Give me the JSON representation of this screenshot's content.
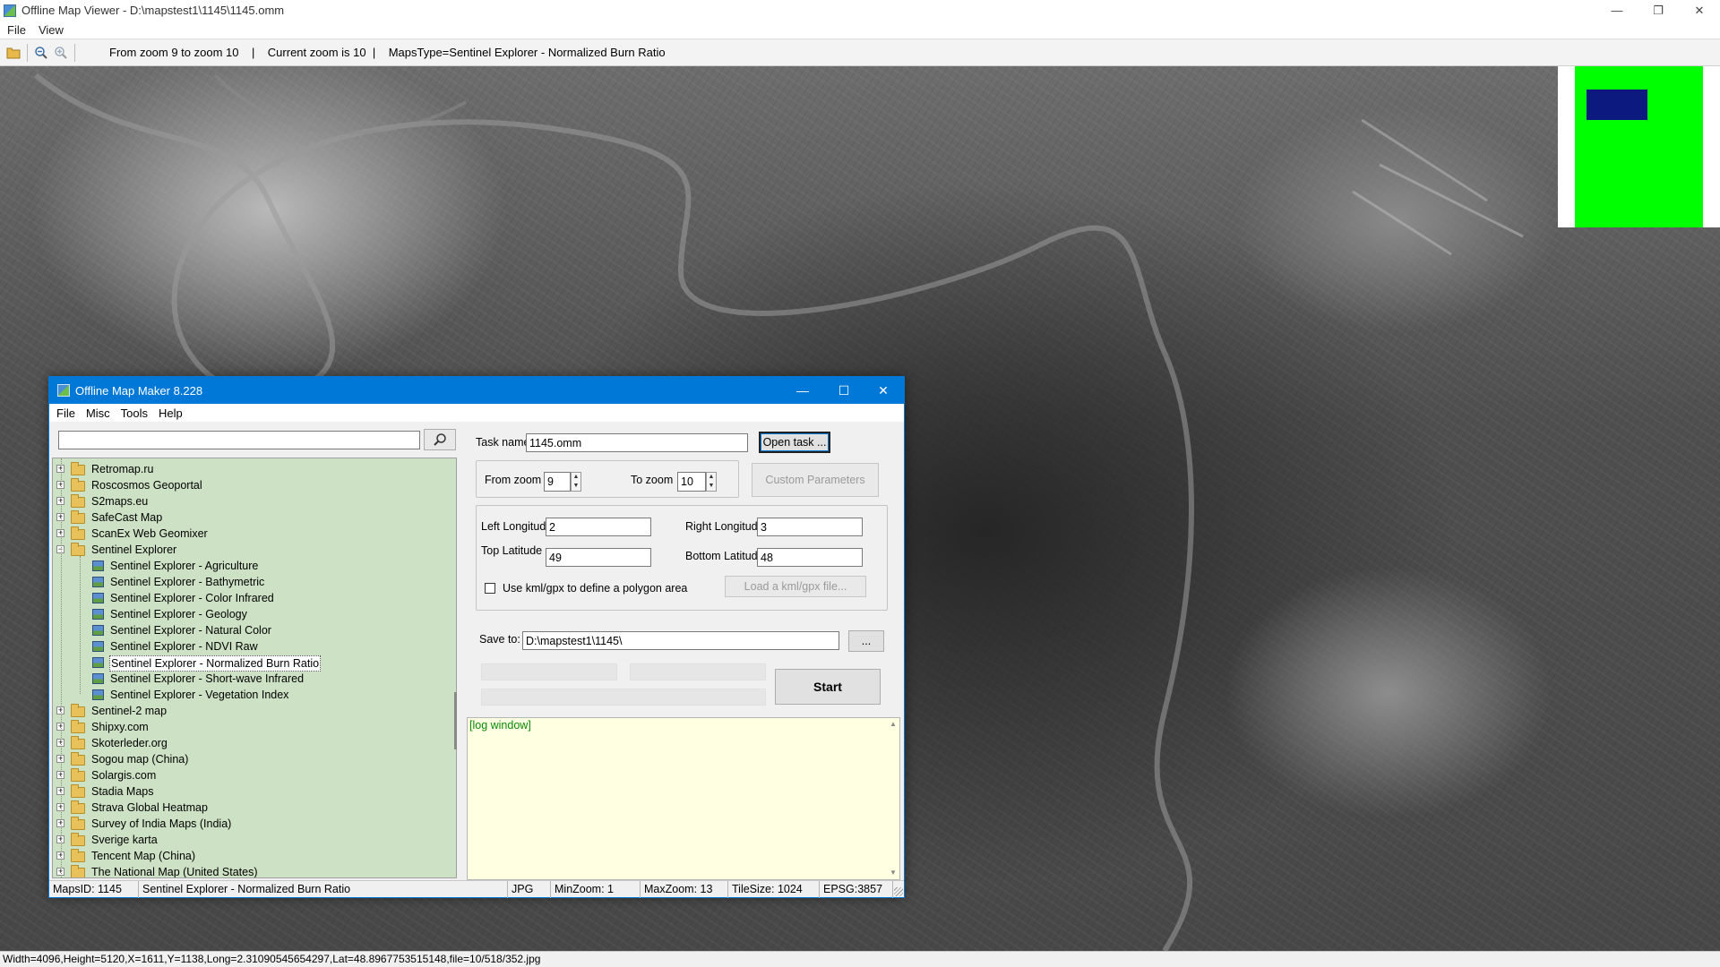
{
  "window": {
    "title": "Offline Map Viewer - D:\\mapstest1\\1145\\1145.omm",
    "menu": [
      "File",
      "View"
    ]
  },
  "toolbar": {
    "zoom_range_text": "From zoom 9 to zoom 10",
    "current_zoom_text": "Current zoom is 10",
    "maps_type_text": "MapsType=Sentinel Explorer - Normalized Burn Ratio",
    "sep": "|"
  },
  "status_bar": {
    "text": "Width=4096,Height=5120,X=1611,Y=1138,Long=2.31090545654297,Lat=48.8967753515148,file=10/518/352.jpg"
  },
  "colors": {
    "overview_green": "#00ff00",
    "overview_view_rect": "#0c1a80",
    "dialog_accent": "#0078d7",
    "tree_background": "#cde1c4",
    "log_background": "#ffffe1",
    "log_text": "#0a8a0a"
  },
  "dialog": {
    "title": "Offline Map Maker 8.228",
    "menu": [
      "File",
      "Misc",
      "Tools",
      "Help"
    ],
    "search": {
      "value": "",
      "placeholder": ""
    },
    "tree": [
      {
        "label": "Retromap.ru",
        "type": "folder"
      },
      {
        "label": "Roscosmos Geoportal",
        "type": "folder"
      },
      {
        "label": "S2maps.eu",
        "type": "folder"
      },
      {
        "label": "SafeCast Map",
        "type": "folder"
      },
      {
        "label": "ScanEx Web Geomixer",
        "type": "folder"
      },
      {
        "label": "Sentinel Explorer",
        "type": "folder",
        "expanded": true
      },
      {
        "label": "Sentinel Explorer - Agriculture",
        "type": "map"
      },
      {
        "label": "Sentinel Explorer - Bathymetric",
        "type": "map"
      },
      {
        "label": "Sentinel Explorer - Color Infrared",
        "type": "map"
      },
      {
        "label": "Sentinel Explorer - Geology",
        "type": "map"
      },
      {
        "label": "Sentinel Explorer - Natural Color",
        "type": "map"
      },
      {
        "label": "Sentinel Explorer - NDVI Raw",
        "type": "map"
      },
      {
        "label": "Sentinel Explorer - Normalized Burn Ratio",
        "type": "map",
        "selected": true
      },
      {
        "label": "Sentinel Explorer - Short-wave Infrared",
        "type": "map"
      },
      {
        "label": "Sentinel Explorer - Vegetation Index",
        "type": "map"
      },
      {
        "label": "Sentinel-2 map",
        "type": "folder"
      },
      {
        "label": "Shipxy.com",
        "type": "folder"
      },
      {
        "label": "Skoterleder.org",
        "type": "folder"
      },
      {
        "label": "Sogou map (China)",
        "type": "folder"
      },
      {
        "label": "Solargis.com",
        "type": "folder"
      },
      {
        "label": "Stadia Maps",
        "type": "folder"
      },
      {
        "label": "Strava Global Heatmap",
        "type": "folder"
      },
      {
        "label": "Survey of India Maps (India)",
        "type": "folder"
      },
      {
        "label": "Sverige karta",
        "type": "folder"
      },
      {
        "label": "Tencent Map (China)",
        "type": "folder"
      },
      {
        "label": "The National Map (United States)",
        "type": "folder"
      }
    ],
    "task_name": {
      "label": "Task name",
      "value": "1145.omm"
    },
    "open_task_label": "Open task ...",
    "from_zoom": {
      "label": "From zoom",
      "value": "9"
    },
    "to_zoom": {
      "label": "To zoom",
      "value": "10"
    },
    "custom_params_label": "Custom Parameters",
    "left_longitude": {
      "label": "Left Longitude",
      "value": "2"
    },
    "right_longitude": {
      "label": "Right Longitude",
      "value": "3"
    },
    "top_latitude": {
      "label": "Top Latitude",
      "value": "49"
    },
    "bottom_latitude": {
      "label": "Bottom Latitude",
      "value": "48"
    },
    "kml_checkbox_label": "Use kml/gpx to define a polygon area",
    "kml_checked": false,
    "load_kml_label": "Load a kml/gpx file...",
    "save_to": {
      "label": "Save to:",
      "value": "D:\\mapstest1\\1145\\"
    },
    "browse_label": "...",
    "start_label": "Start",
    "log_text": "[log window]",
    "status": {
      "maps_id": "MapsID: 1145",
      "map_name": "Sentinel Explorer - Normalized Burn Ratio",
      "format": "JPG",
      "min_zoom": "MinZoom: 1",
      "max_zoom": "MaxZoom: 13",
      "tile_size": "TileSize: 1024",
      "epsg": "EPSG:3857"
    }
  }
}
